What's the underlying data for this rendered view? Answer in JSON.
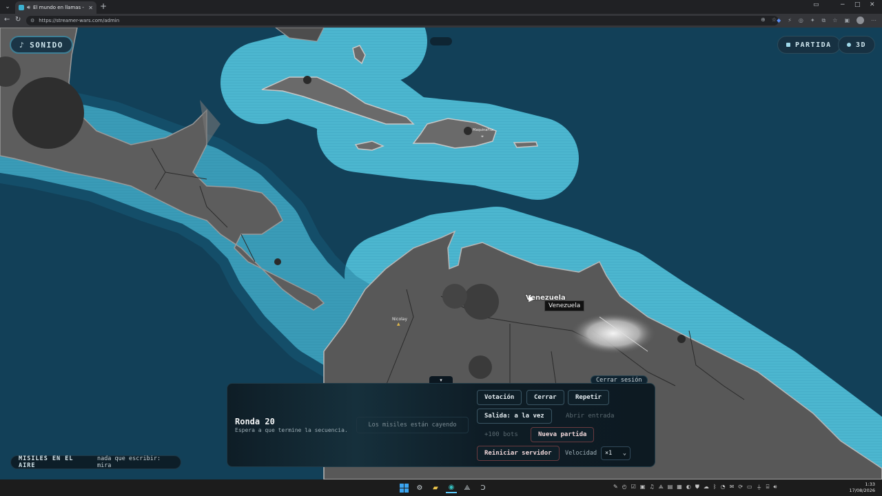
{
  "browser": {
    "tab_title": "El mundo en llamas - director",
    "tab_audio_icon": "speaker-icon",
    "url": "https://streamer-wars.com/admin",
    "window_controls": [
      "−",
      "□",
      "✕"
    ]
  },
  "hud": {
    "sound_label": "SONIDO",
    "match_label": "PARTIDA",
    "view_label": "3D"
  },
  "map": {
    "country_hover": "Venezuela",
    "tooltip": "Venezuela",
    "markers": [
      {
        "label": "MaquinaFlix"
      },
      {
        "label": "Nicolay"
      }
    ]
  },
  "panel": {
    "toggle": "▾",
    "logout": "Cerrar sesión",
    "round_title": "Ronda 20",
    "round_subtitle": "Espera a que termine la secuencia.",
    "status": "Los misiles están cayendo",
    "buttons": {
      "vote": "Votación",
      "close": "Cerrar",
      "repeat": "Repetir",
      "exit_mode": "Salida: a la vez",
      "open_entry": "Abrir entrada",
      "add_bots": "+100 bots",
      "new_match": "Nueva partida",
      "restart_server": "Reiniciar servidor"
    },
    "speed_label": "Velocidad",
    "speed_value": "×1"
  },
  "missiles": {
    "label": "MISILES EN EL AIRE",
    "value": "nada que escribir: mira"
  },
  "taskbar": {
    "time": "1:33",
    "date": "17/08/2026"
  },
  "colors": {
    "ocean": "#124058",
    "coast_glow": "#45b2cc",
    "land": "#5a5a5a",
    "accent": "#9fd9ea"
  }
}
